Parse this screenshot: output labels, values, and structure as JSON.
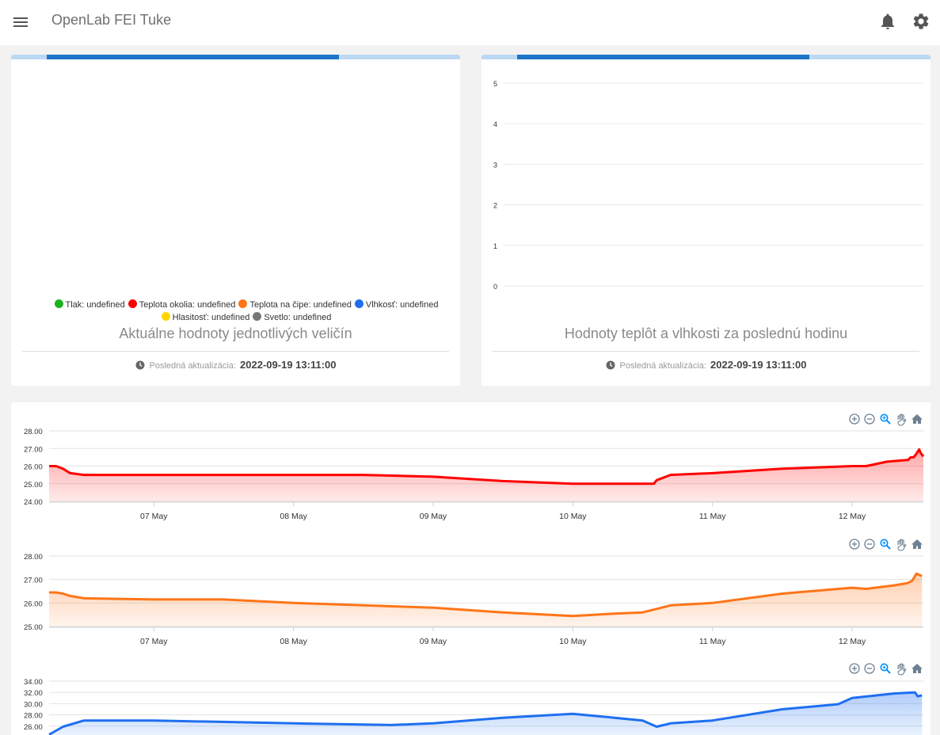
{
  "header": {
    "title": "OpenLab FEI Tuke",
    "menu_icon": "hamburger-menu-icon",
    "notifications_icon": "bell-icon",
    "settings_icon": "gear-icon"
  },
  "current_values_card": {
    "progress": 0.65,
    "legend": [
      {
        "label": "Tlak: undefined",
        "color": "#1db31d"
      },
      {
        "label": "Teplota okolia: undefined",
        "color": "#ff0000"
      },
      {
        "label": "Teplota na čipe: undefined",
        "color": "#ff7518"
      },
      {
        "label": "Vlhkosť: undefined",
        "color": "#1e6ff0"
      },
      {
        "label": "Hlasitosť: undefined",
        "color": "#ffd400"
      },
      {
        "label": "Svetlo: undefined",
        "color": "#777777"
      }
    ],
    "title": "Aktuálne hodnoty jednotlivých veličín",
    "footer_label": "Posledná aktualizácia:",
    "footer_time": "2022-09-19 13:11:00"
  },
  "last_hour_card": {
    "progress": 0.65,
    "title": "Hodnoty teplôt a vlhkosti za poslednú hodinu",
    "footer_label": "Posledná aktualizácia:",
    "footer_time": "2022-09-19 13:11:00"
  },
  "toolbar_icons": [
    "zoom-in-icon",
    "zoom-out-icon",
    "selection-zoom-icon",
    "pan-hand-icon",
    "home-reset-icon"
  ],
  "chart_data": [
    {
      "type": "line",
      "y_ticks": [
        "0",
        "1",
        "2",
        "3",
        "4",
        "5"
      ],
      "ylim": [
        0,
        5
      ],
      "series": [],
      "grid": true
    },
    {
      "type": "area",
      "color": "#ff0000",
      "x_ticks": [
        "07 May",
        "08 May",
        "09 May",
        "10 May",
        "11 May",
        "12 May"
      ],
      "y_ticks": [
        "24.00",
        "25.00",
        "26.00",
        "27.00",
        "28.00"
      ],
      "ylim": [
        24,
        28
      ],
      "x": [
        6.25,
        6.3,
        6.35,
        6.4,
        6.5,
        7,
        7.5,
        8,
        8.5,
        9,
        9.5,
        10,
        10.3,
        10.58,
        10.6,
        10.7,
        11,
        11.5,
        12,
        12.1,
        12.25,
        12.4,
        12.42,
        12.44,
        12.46,
        12.48,
        12.49,
        12.51
      ],
      "values": [
        26.0,
        26.0,
        25.85,
        25.6,
        25.5,
        25.5,
        25.5,
        25.5,
        25.5,
        25.4,
        25.15,
        25.0,
        25.0,
        25.0,
        25.2,
        25.5,
        25.6,
        25.85,
        26.0,
        26.0,
        26.25,
        26.35,
        26.5,
        26.5,
        26.7,
        26.95,
        26.75,
        26.55
      ],
      "grid": true
    },
    {
      "type": "area",
      "color": "#ff7518",
      "x_ticks": [
        "07 May",
        "08 May",
        "09 May",
        "10 May",
        "11 May",
        "12 May"
      ],
      "y_ticks": [
        "25.00",
        "26.00",
        "27.00",
        "28.00"
      ],
      "ylim": [
        25,
        28
      ],
      "x": [
        6.25,
        6.3,
        6.35,
        6.4,
        6.5,
        7,
        7.5,
        8,
        8.5,
        9,
        9.5,
        10,
        10.3,
        10.5,
        10.6,
        10.7,
        11,
        11.5,
        11.9,
        12,
        12.1,
        12.3,
        12.35,
        12.4,
        12.43,
        12.46,
        12.5
      ],
      "values": [
        26.45,
        26.45,
        26.4,
        26.3,
        26.2,
        26.15,
        26.15,
        26.0,
        25.9,
        25.8,
        25.6,
        25.45,
        25.55,
        25.6,
        25.75,
        25.9,
        26.0,
        26.4,
        26.6,
        26.65,
        26.6,
        26.75,
        26.8,
        26.85,
        26.95,
        27.25,
        27.15
      ],
      "grid": true
    },
    {
      "type": "area",
      "color": "#1e6ff0",
      "y_ticks": [
        "26.00",
        "28.00",
        "30.00",
        "32.00",
        "34.00"
      ],
      "ylim": [
        24,
        34
      ],
      "x": [
        6.25,
        6.35,
        6.5,
        7,
        8,
        8.7,
        9,
        9.5,
        10,
        10.5,
        10.6,
        10.7,
        11,
        11.5,
        11.9,
        12,
        12.3,
        12.45,
        12.47,
        12.5
      ],
      "values": [
        24.5,
        25.9,
        27.0,
        27.0,
        26.5,
        26.2,
        26.5,
        27.5,
        28.2,
        27.0,
        25.9,
        26.5,
        27.0,
        29.0,
        29.9,
        31.0,
        31.8,
        32.0,
        31.3,
        31.5
      ],
      "grid": true
    }
  ]
}
